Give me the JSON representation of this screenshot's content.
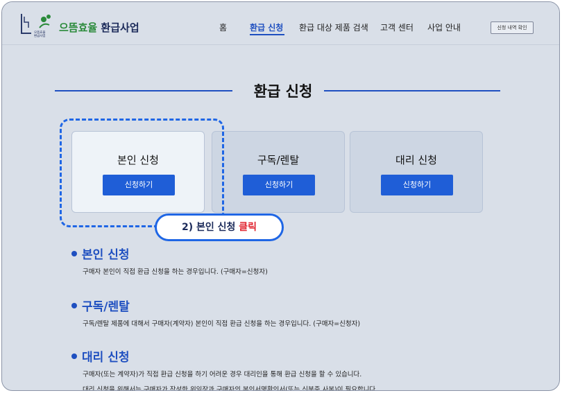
{
  "header": {
    "logo_small": "으뜸효율\n환급사업",
    "logo_title_part1": "으뜸효율",
    "logo_title_part2": " 환급사업",
    "nav": [
      {
        "label": "홈"
      },
      {
        "label": "환급 신청"
      },
      {
        "label": "환급 대상 제품 검색"
      },
      {
        "label": "고객 센터"
      },
      {
        "label": "사업 안내"
      }
    ],
    "active_nav": "환급 신청",
    "check_button": "신청 내역 확인"
  },
  "page": {
    "title": "환급 신청"
  },
  "cards": [
    {
      "title": "본인 신청",
      "button": "신청하기"
    },
    {
      "title": "구독/렌탈",
      "button": "신청하기"
    },
    {
      "title": "대리 신청",
      "button": "신청하기"
    }
  ],
  "callout": {
    "text": "2) 본인 신청 ",
    "highlight": "클릭"
  },
  "sections": [
    {
      "heading": "본인 신청",
      "desc": "구매자 본인이 직접 환급 신청을 하는 경우입니다. (구매자=신청자)"
    },
    {
      "heading": "구독/렌탈",
      "desc": "구독/렌탈 제품에 대해서 구매자(계약자) 본인이 직접 환급 신청을 하는 경우입니다. (구매자=신청자)"
    },
    {
      "heading": "대리 신청",
      "desc": "구매자(또는 계약자)가 직접 환급 신청을 하기 어려운 경우 대리인을 통해 환급 신청을 할 수 있습니다.",
      "desc2": "대리 신청을 위해서는 구매자가 작성한 위임장과 구매자의 본인서명확인서(또는 신분증 사본)이 필요합니다."
    }
  ],
  "colors": {
    "accent": "#1e4fc0",
    "button": "#1f5ed7",
    "highlight": "#1f66e5",
    "callout_red": "#e0242f",
    "background": "#d9dfe8"
  }
}
